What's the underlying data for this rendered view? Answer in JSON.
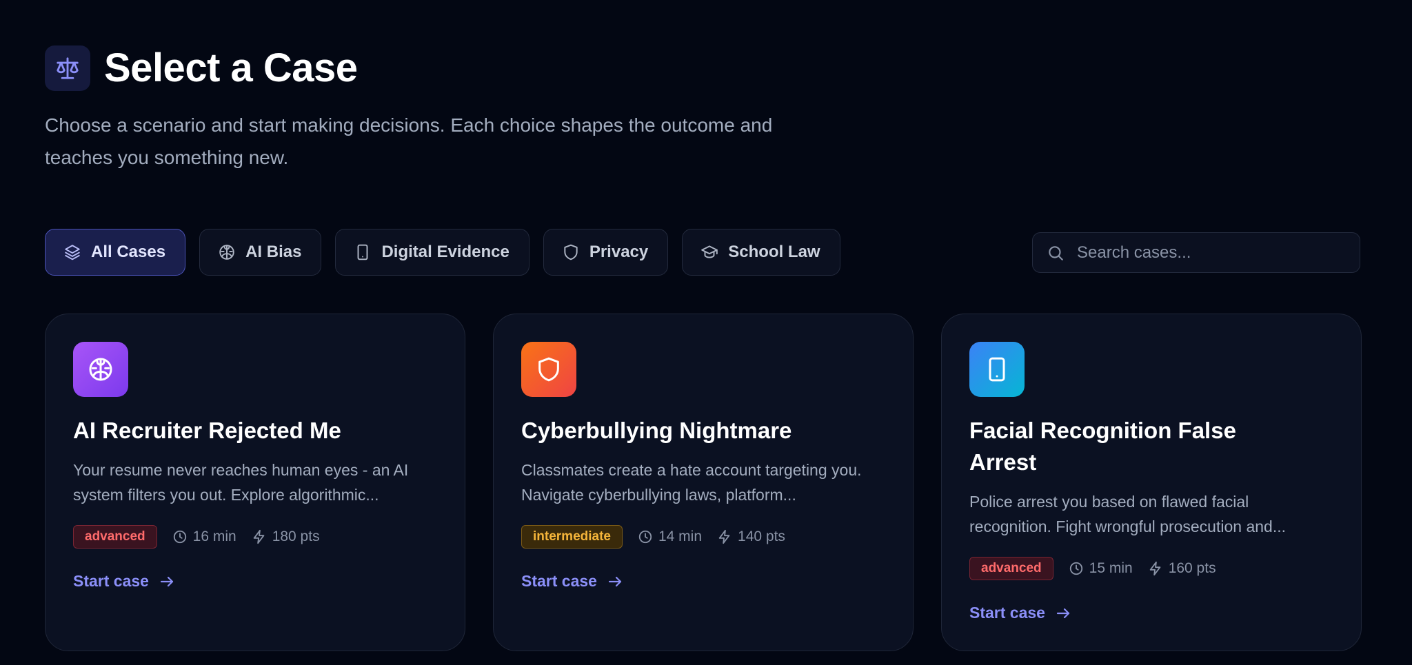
{
  "header": {
    "logo_icon": "scale-icon",
    "title": "Select a Case",
    "subtitle": "Choose a scenario and start making decisions. Each choice shapes the outcome and teaches you something new."
  },
  "filters": [
    {
      "label": "All Cases",
      "icon": "layers-icon",
      "active": true
    },
    {
      "label": "AI Bias",
      "icon": "brain-icon",
      "active": false
    },
    {
      "label": "Digital Evidence",
      "icon": "smartphone-icon",
      "active": false
    },
    {
      "label": "Privacy",
      "icon": "shield-icon",
      "active": false
    },
    {
      "label": "School Law",
      "icon": "graduation-cap-icon",
      "active": false
    }
  ],
  "search": {
    "placeholder": "Search cases...",
    "value": ""
  },
  "cards": [
    {
      "icon": "brain-icon",
      "gradient": [
        "#a855f7",
        "#7c3aed"
      ],
      "title": "AI Recruiter Rejected Me",
      "description": "Your resume never reaches human eyes - an AI system filters you out. Explore algorithmic...",
      "difficulty": "advanced",
      "duration": "16 min",
      "points": "180 pts",
      "cta": "Start case"
    },
    {
      "icon": "shield-icon",
      "gradient": [
        "#f97316",
        "#ef4444"
      ],
      "title": "Cyberbullying Nightmare",
      "description": "Classmates create a hate account targeting you. Navigate cyberbullying laws, platform...",
      "difficulty": "intermediate",
      "duration": "14 min",
      "points": "140 pts",
      "cta": "Start case"
    },
    {
      "icon": "smartphone-icon",
      "gradient": [
        "#3b82f6",
        "#06b6d4"
      ],
      "title": "Facial Recognition False Arrest",
      "description": "Police arrest you based on flawed facial recognition. Fight wrongful prosecution and...",
      "difficulty": "advanced",
      "duration": "15 min",
      "points": "160 pts",
      "cta": "Start case"
    }
  ],
  "colors": {
    "background": "#030713",
    "accent": "#8b8ff8",
    "advanced": "#ff6b6b",
    "intermediate": "#f5b53a"
  }
}
